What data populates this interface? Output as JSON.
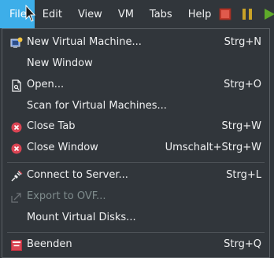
{
  "menubar": {
    "items": [
      {
        "label": "File"
      },
      {
        "label": "Edit"
      },
      {
        "label": "View"
      },
      {
        "label": "VM"
      },
      {
        "label": "Tabs"
      },
      {
        "label": "Help"
      }
    ],
    "toolbar_icons": [
      "stop-icon",
      "pause-icon",
      "play-icon"
    ]
  },
  "file_menu": {
    "items": [
      {
        "label": "New Virtual Machine...",
        "shortcut": "Strg+N",
        "icon": "new-vm-icon"
      },
      {
        "label": "New Window",
        "shortcut": ""
      },
      {
        "label": "Open...",
        "shortcut": "Strg+O",
        "icon": "open-file-icon"
      },
      {
        "label": "Scan for Virtual Machines...",
        "shortcut": ""
      },
      {
        "label": "Close Tab",
        "shortcut": "Strg+W",
        "icon": "close-circle-icon"
      },
      {
        "label": "Close Window",
        "shortcut": "Umschalt+Strg+W",
        "icon": "close-circle-icon"
      },
      {
        "label": "Connect to Server...",
        "shortcut": "Strg+L",
        "icon": "connect-plug-icon"
      },
      {
        "label": "Export to OVF...",
        "shortcut": "",
        "disabled": true,
        "icon": "export-icon"
      },
      {
        "label": "Mount Virtual Disks...",
        "shortcut": ""
      },
      {
        "label": "Beenden",
        "shortcut": "Strg+Q",
        "icon": "quit-icon"
      }
    ]
  },
  "colors": {
    "background": "#31363b",
    "highlight": "#3daee9",
    "close_icon": "#da4453",
    "text": "#eff0f1",
    "disabled_text": "#7f8c8d"
  }
}
